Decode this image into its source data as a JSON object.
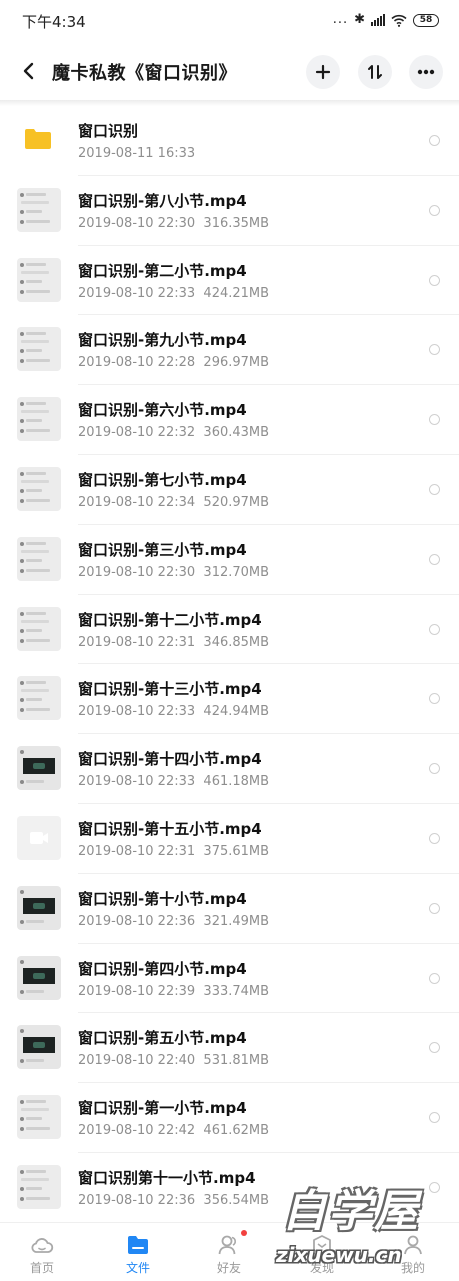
{
  "status_bar": {
    "time": "下午4:34",
    "dots": "...",
    "battery": "58"
  },
  "header": {
    "title": "魔卡私教《窗口识别》",
    "back_icon": "chevron-left-icon",
    "add_icon": "plus-icon",
    "sort_icon": "sort-icon",
    "more_icon": "more-horizontal-icon"
  },
  "files": [
    {
      "name": "窗口识别",
      "date": "2019-08-11  16:33",
      "size": "",
      "type": "folder"
    },
    {
      "name": "窗口识别-第八小节.mp4",
      "date": "2019-08-10  22:30",
      "size": "316.35MB",
      "type": "chat"
    },
    {
      "name": "窗口识别-第二小节.mp4",
      "date": "2019-08-10  22:33",
      "size": "424.21MB",
      "type": "chat"
    },
    {
      "name": "窗口识别-第九小节.mp4",
      "date": "2019-08-10  22:28",
      "size": "296.97MB",
      "type": "chat"
    },
    {
      "name": "窗口识别-第六小节.mp4",
      "date": "2019-08-10  22:32",
      "size": "360.43MB",
      "type": "chat"
    },
    {
      "name": "窗口识别-第七小节.mp4",
      "date": "2019-08-10  22:34",
      "size": "520.97MB",
      "type": "chat"
    },
    {
      "name": "窗口识别-第三小节.mp4",
      "date": "2019-08-10  22:30",
      "size": "312.70MB",
      "type": "chat"
    },
    {
      "name": "窗口识别-第十二小节.mp4",
      "date": "2019-08-10  22:31",
      "size": "346.85MB",
      "type": "chat"
    },
    {
      "name": "窗口识别-第十三小节.mp4",
      "date": "2019-08-10  22:33",
      "size": "424.94MB",
      "type": "chat"
    },
    {
      "name": "窗口识别-第十四小节.mp4",
      "date": "2019-08-10  22:33",
      "size": "461.18MB",
      "type": "dark"
    },
    {
      "name": "窗口识别-第十五小节.mp4",
      "date": "2019-08-10  22:31",
      "size": "375.61MB",
      "type": "video"
    },
    {
      "name": "窗口识别-第十小节.mp4",
      "date": "2019-08-10  22:36",
      "size": "321.49MB",
      "type": "dark"
    },
    {
      "name": "窗口识别-第四小节.mp4",
      "date": "2019-08-10  22:39",
      "size": "333.74MB",
      "type": "dark"
    },
    {
      "name": "窗口识别-第五小节.mp4",
      "date": "2019-08-10  22:40",
      "size": "531.81MB",
      "type": "dark"
    },
    {
      "name": "窗口识别-第一小节.mp4",
      "date": "2019-08-10  22:42",
      "size": "461.62MB",
      "type": "chat"
    },
    {
      "name": "窗口识别第十一小节.mp4",
      "date": "2019-08-10  22:36",
      "size": "356.54MB",
      "type": "chat"
    }
  ],
  "bottom_nav": [
    {
      "label": "首页",
      "icon": "home-cloud-icon",
      "active": false
    },
    {
      "label": "文件",
      "icon": "folder-icon",
      "active": true
    },
    {
      "label": "好友",
      "icon": "friends-icon",
      "active": false
    },
    {
      "label": "发现",
      "icon": "discover-icon",
      "active": false
    },
    {
      "label": "我的",
      "icon": "profile-icon",
      "active": false
    }
  ],
  "watermark": {
    "text_cn": "自学屋",
    "text_en": "zixuewu.cn"
  },
  "colors": {
    "accent": "#2187f4",
    "folder": "#f7c125",
    "badge": "#f2413f"
  }
}
